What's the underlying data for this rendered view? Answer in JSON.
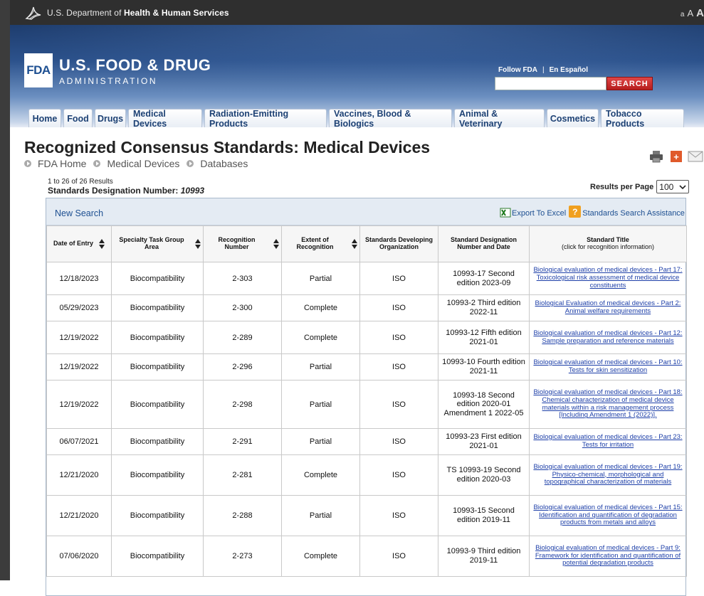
{
  "hhs": {
    "prefix": "U.S. Department of ",
    "bold": "Health & Human Services",
    "font_controls": [
      "a",
      "A",
      "A"
    ]
  },
  "header": {
    "logo_text": "FDA",
    "name_line1": "U.S. FOOD & DRUG",
    "name_line2": "ADMINISTRATION",
    "follow_link": "Follow FDA",
    "separator": "|",
    "espanol_link": "En Español",
    "search_value": "",
    "search_button": "SEARCH"
  },
  "nav": {
    "tabs": [
      {
        "label": "Home"
      },
      {
        "label": "Food"
      },
      {
        "label": "Drugs"
      },
      {
        "label": "Medical Devices"
      },
      {
        "label": "Radiation-Emitting Products"
      },
      {
        "label": "Vaccines, Blood & Biologics"
      },
      {
        "label": "Animal & Veterinary"
      },
      {
        "label": "Cosmetics"
      },
      {
        "label": "Tobacco Products"
      }
    ]
  },
  "page": {
    "title": "Recognized Consensus Standards: Medical Devices",
    "breadcrumb": [
      "FDA Home",
      "Medical Devices",
      "Databases"
    ]
  },
  "results": {
    "count_text": "1 to 26 of 26 Results",
    "designation_label": "Standards Designation Number: ",
    "designation_value": "10993",
    "per_page_label": "Results per Page",
    "per_page_value": "100"
  },
  "panel": {
    "new_search": "New Search",
    "export_label": "Export To Excel",
    "help_label": "Standards Search Assistance"
  },
  "table": {
    "headers": {
      "date": "Date of Entry",
      "specialty": "Specialty Task Group Area",
      "recognition_number": "Recognition Number",
      "extent": "Extent of Recognition",
      "sdo": "Standards Developing Organization",
      "designation": "Standard Designation Number and Date",
      "title": "Standard Title",
      "title_sub": "(click for recognition information)"
    },
    "rows": [
      {
        "date": "12/18/2023",
        "area": "Biocompatibility",
        "rec": "2-303",
        "extent": "Partial",
        "sdo": "ISO",
        "desig": "10993-17 Second edition 2023-09",
        "title": "Biological evaluation of medical devices - Part 17: Toxicological risk assessment of medical device constituents"
      },
      {
        "date": "05/29/2023",
        "area": "Biocompatibility",
        "rec": "2-300",
        "extent": "Complete",
        "sdo": "ISO",
        "desig": "10993-2 Third edition 2022-11",
        "title": "Biological Evaluation of medical devices - Part 2: Animal welfare requirements"
      },
      {
        "date": "12/19/2022",
        "area": "Biocompatibility",
        "rec": "2-289",
        "extent": "Complete",
        "sdo": "ISO",
        "desig": "10993-12 Fifth edition 2021-01",
        "title": "Biological evaluation of medical devices - Part 12: Sample preparation and reference materials"
      },
      {
        "date": "12/19/2022",
        "area": "Biocompatibility",
        "rec": "2-296",
        "extent": "Partial",
        "sdo": "ISO",
        "desig": "10993-10 Fourth edition 2021-11",
        "title": "Biological evaluation of medical devices - Part 10: Tests for skin sensitization"
      },
      {
        "date": "12/19/2022",
        "area": "Biocompatibility",
        "rec": "2-298",
        "extent": "Partial",
        "sdo": "ISO",
        "desig": "10993-18 Second edition 2020-01 Amendment 1 2022-05",
        "title": "Biological evaluation of medical devices - Part 18: Chemical characterization of medical device materials within a risk management process [Including Amendment 1 (2022)]."
      },
      {
        "date": "06/07/2021",
        "area": "Biocompatibility",
        "rec": "2-291",
        "extent": "Partial",
        "sdo": "ISO",
        "desig": "10993-23 First edition 2021-01",
        "title": "Biological evaluation of medical devices - Part 23: Tests for irritation"
      },
      {
        "date": "12/21/2020",
        "area": "Biocompatibility",
        "rec": "2-281",
        "extent": "Complete",
        "sdo": "ISO",
        "desig": "TS 10993-19 Second edition 2020-03",
        "title": "Biological evaluation of medical devices - Part 19: Physico-chemical, morphological and topographical characterization of materials"
      },
      {
        "date": "12/21/2020",
        "area": "Biocompatibility",
        "rec": "2-288",
        "extent": "Partial",
        "sdo": "ISO",
        "desig": "10993-15 Second edition 2019-11",
        "title": "Biological evaluation of medical devices - Part 15: Identification and quantification of degradation products from metals and alloys"
      },
      {
        "date": "07/06/2020",
        "area": "Biocompatibility",
        "rec": "2-273",
        "extent": "Complete",
        "sdo": "ISO",
        "desig": "10993-9 Third edition 2019-11",
        "title": "Biological evaluation of medical devices - Part 9: Framework for identification and quantification of potential degradation products"
      }
    ]
  }
}
